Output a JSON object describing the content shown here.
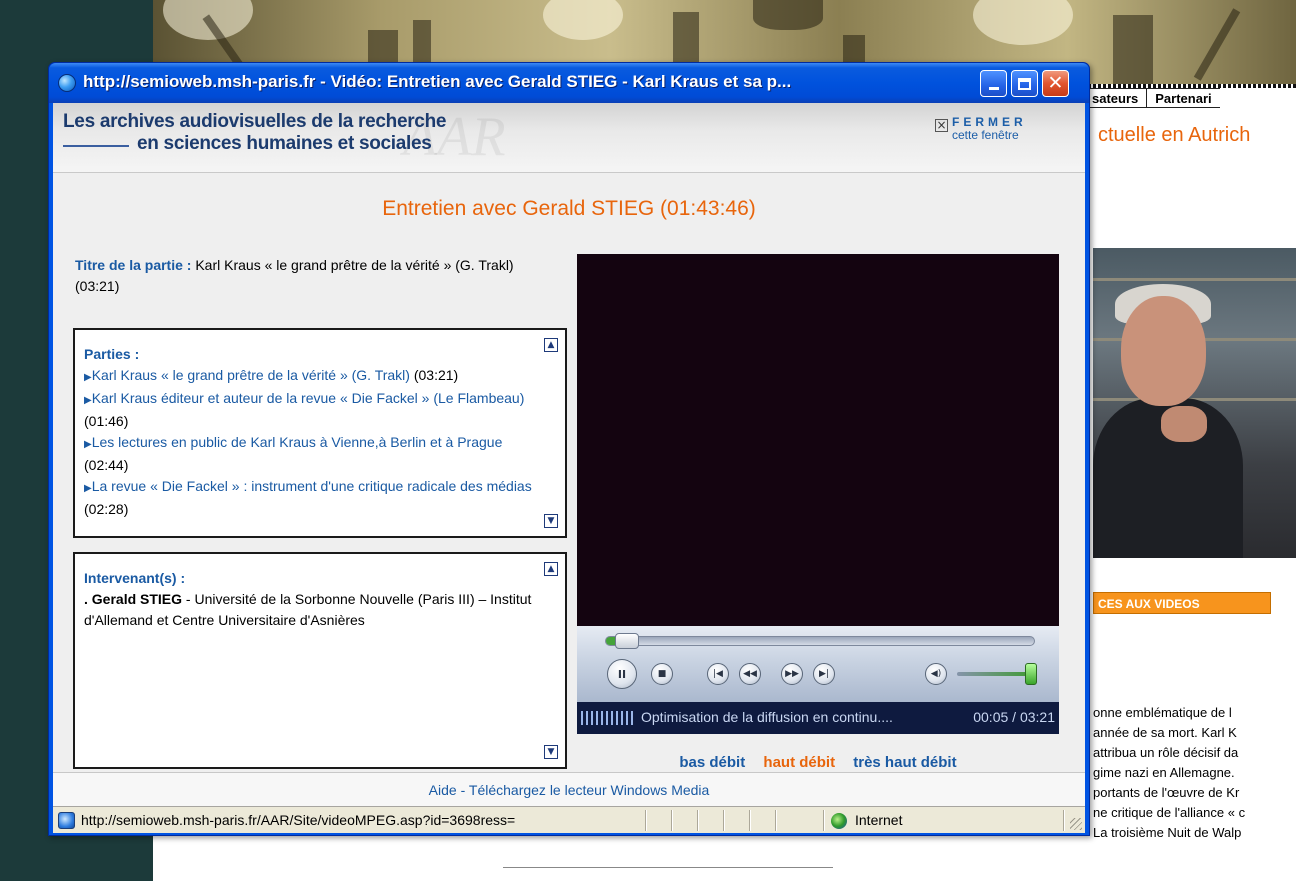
{
  "background": {
    "nav": [
      "sateurs",
      "Partenari"
    ],
    "heading": "ctuelle en Autrich",
    "videos_bar": "CES AUX VIDEOS",
    "text_lines": [
      "onne emblématique de l",
      " année de sa mort. Karl K",
      " attribua un rôle décisif da",
      "gime nazi en Allemagne.",
      "portants de l'œuvre de Kr",
      "ne critique de l'alliance « c",
      " La troisième Nuit de Walp"
    ]
  },
  "window": {
    "title": "http://semioweb.msh-paris.fr - Vidéo: Entretien avec Gerald STIEG - Karl Kraus et sa p...",
    "buttons": {
      "minimize": "_",
      "maximize": "□",
      "close": "✕"
    }
  },
  "header": {
    "line1": "Les archives audiovisuelles de la recherche",
    "line2": "en sciences humaines et sociales",
    "watermark": "AAR",
    "close_big": "FERMER",
    "close_small": "cette fenêtre"
  },
  "video": {
    "title": "Entretien avec Gerald STIEG (01:43:46)",
    "part_label": "Titre de la partie :",
    "part_value": " Karl Kraus « le grand prêtre de la vérité » (G. Trakl) (03:21)"
  },
  "parties": {
    "heading": "Parties :",
    "items": [
      {
        "title": "Karl Kraus « le grand prêtre de la vérité » (G. Trakl)",
        "time": " (03:21)"
      },
      {
        "title": "Karl Kraus éditeur et auteur de la revue « Die Fackel » (Le Flambeau)",
        "time": " (01:46)"
      },
      {
        "title": "Les lectures en public de Karl Kraus à Vienne,à Berlin et à Prague",
        "time": " (02:44)"
      },
      {
        "title": "La revue « Die Fackel » : instrument d'une critique radicale des médias",
        "time": " (02:28)"
      }
    ]
  },
  "intervenants": {
    "heading": "Intervenant(s) :",
    "prefix": ". ",
    "name": "Gerald STIEG",
    "affiliation": " - Université de la Sorbonne Nouvelle (Paris III) – Institut d'Allemand et Centre Universitaire d'Asnières"
  },
  "player": {
    "progress": 0.05,
    "volume": 1.0,
    "status_message": "Optimisation de la diffusion en continu....",
    "elapsed": "00:05",
    "duration": "03:21",
    "controls": {
      "pause": "II",
      "stop": "■",
      "prev": "|◀",
      "rewind": "◀◀",
      "fast_forward": "▶▶",
      "next": "▶|",
      "mute": "◀)"
    }
  },
  "quality": {
    "low": "bas débit",
    "high": "haut débit",
    "very_high": "très haut débit"
  },
  "footer": {
    "help": "Aide",
    "separator": " - ",
    "download": "Téléchargez le lecteur Windows Media"
  },
  "ie_status": {
    "url": "http://semioweb.msh-paris.fr/AAR/Site/videoMPEG.asp?id=3698ress=",
    "zone": "Internet"
  },
  "colors": {
    "accent_orange": "#e8650c",
    "link_blue": "#1a5aa3",
    "titlebar_blue": "#0054e3"
  }
}
